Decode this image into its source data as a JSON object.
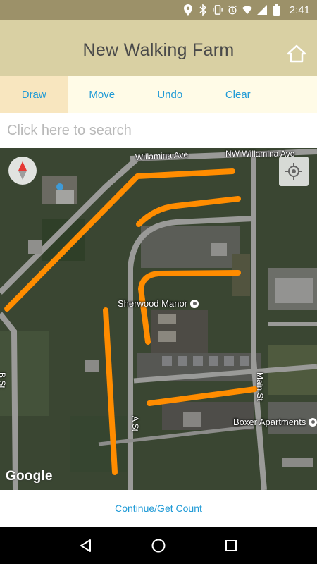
{
  "status_bar": {
    "time": "2:41",
    "icons": [
      "location-icon",
      "bluetooth-icon",
      "vibrate-icon",
      "alarm-icon",
      "wifi-icon",
      "signal-icon",
      "battery-icon"
    ]
  },
  "header": {
    "title": "New Walking Farm",
    "home_icon": "home-icon"
  },
  "toolbar": {
    "tabs": [
      {
        "label": "Draw",
        "active": true
      },
      {
        "label": "Move",
        "active": false
      },
      {
        "label": "Undo",
        "active": false
      },
      {
        "label": "Clear",
        "active": false
      }
    ]
  },
  "search": {
    "placeholder": "Click here to search",
    "value": ""
  },
  "map": {
    "street_labels": [
      "Willamina Ave",
      "NW Willamina Ave",
      "B St",
      "A St",
      "Main St"
    ],
    "poi_labels": [
      "Sherwood Manor",
      "Boxer Apartments"
    ],
    "attribution": "Google",
    "route_color": "#ff8c00"
  },
  "footer": {
    "continue_label": "Continue/Get Count"
  },
  "nav_bar": {
    "buttons": [
      "back-icon",
      "home-circle-icon",
      "recents-icon"
    ]
  },
  "colors": {
    "status_bar": "#9c9169",
    "header": "#d9d0a3",
    "toolbar": "#fffbe7",
    "active_tab": "#f8e6bf",
    "accent": "#1f9ad6"
  }
}
